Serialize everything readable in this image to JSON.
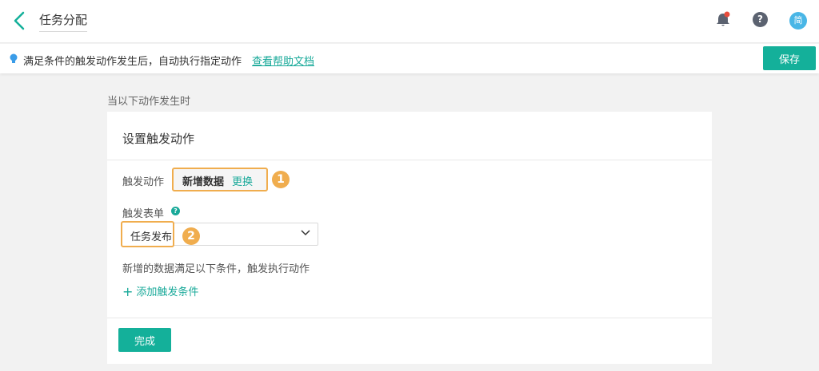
{
  "header": {
    "title": "任务分配",
    "avatar_text": "简",
    "help_glyph": "?",
    "notification_dot_color": "#e74c3c"
  },
  "infobar": {
    "text": "满足条件的触发动作发生后，自动执行指定动作",
    "link": "查看帮助文档",
    "save_label": "保存"
  },
  "section": {
    "label": "当以下动作发生时"
  },
  "card": {
    "title": "设置触发动作",
    "trigger": {
      "label": "触发动作",
      "value": "新增数据",
      "change_label": "更换",
      "badge": "1"
    },
    "form": {
      "label": "触发表单",
      "help_glyph": "?",
      "selected": "任务发布",
      "badge": "2"
    },
    "condition_text": "新增的数据满足以下条件，触发执行动作",
    "add_condition_plus": "+",
    "add_condition_label": "添加触发条件",
    "done_label": "完成"
  },
  "colors": {
    "accent": "#14b09a",
    "highlight": "#f0ad4e",
    "background": "#f2f2f2"
  }
}
